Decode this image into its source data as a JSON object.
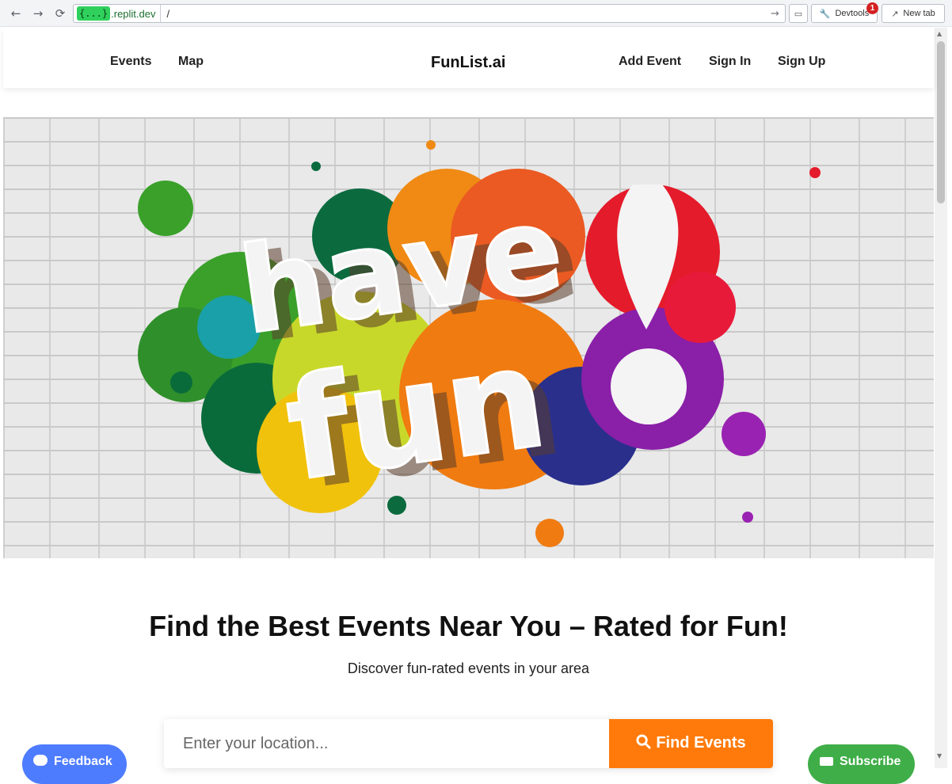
{
  "browser": {
    "url_chip": "{...}",
    "url_domain": ".replit.dev",
    "url_path": "/",
    "devtools_label": "Devtools",
    "devtools_badge": "1",
    "newtab_label": "New tab"
  },
  "header": {
    "nav_left": [
      "Events",
      "Map"
    ],
    "brand": "FunList.ai",
    "nav_right": [
      "Add Event",
      "Sign In",
      "Sign Up"
    ]
  },
  "hero": {
    "line1": "have",
    "line2": "fun"
  },
  "main": {
    "headline": "Find the Best Events Near You – Rated for Fun!",
    "subheadline": "Discover fun-rated events in your area"
  },
  "search": {
    "placeholder": "Enter your location...",
    "button_label": "Find Events"
  },
  "floating": {
    "feedback_label": "Feedback",
    "subscribe_label": "Subscribe"
  },
  "colors": {
    "accent": "#ff7a0a",
    "feedback": "#4e7cff",
    "subscribe": "#3fae48"
  }
}
